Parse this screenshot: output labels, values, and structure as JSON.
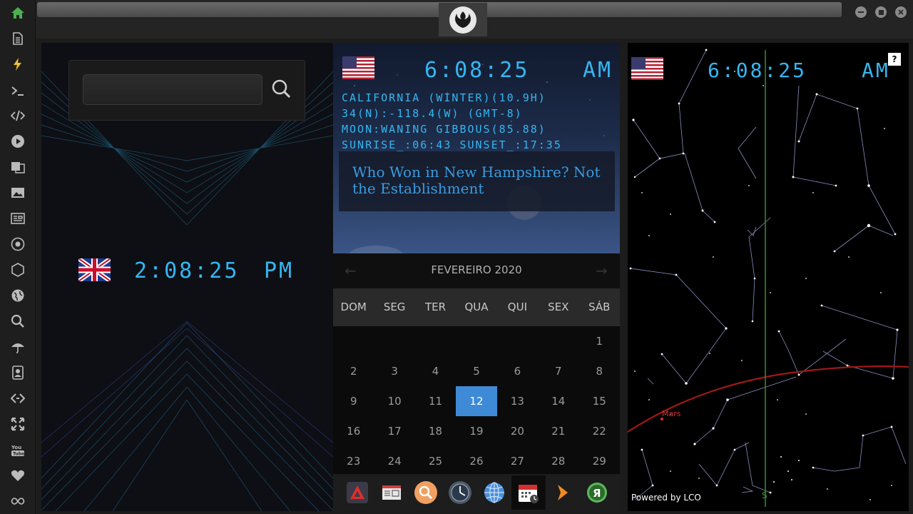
{
  "sidebar": {
    "icons": [
      "home-icon",
      "document-icon",
      "lightning-icon",
      "terminal-icon",
      "code-icon",
      "play-icon",
      "translate-icon",
      "image-icon",
      "news-icon",
      "aperture-icon",
      "hexagon-icon",
      "globe-icon",
      "search-icon",
      "umbrella-icon",
      "contacts-icon",
      "code-tag-icon",
      "expand-icon",
      "youtube-icon",
      "heart-icon",
      "infinity-icon"
    ],
    "accent": "#4caf50"
  },
  "search": {
    "value": "",
    "placeholder": ""
  },
  "uk_clock": {
    "time": "2:08:25",
    "ampm": "PM"
  },
  "us_clock": {
    "time": "6:08:25",
    "ampm": "AM",
    "lines": [
      "CALIFORNIA (WINTER)(10.9H)",
      "34(N):-118.4(W) (GMT-8)",
      "MOON:WANING GIBBOUS(85.88)",
      "SUNRISE_:06:43 SUNSET_:17:35"
    ]
  },
  "news": {
    "headline": "Who Won in New Hampshire? Not the Establishment"
  },
  "calendar": {
    "title": "FEVEREIRO 2020",
    "days": [
      "DOM",
      "SEG",
      "TER",
      "QUA",
      "QUI",
      "SEX",
      "SÁB"
    ],
    "weeks": [
      [
        "",
        "",
        "",
        "",
        "",
        "",
        "1"
      ],
      [
        "2",
        "3",
        "4",
        "5",
        "6",
        "7",
        "8"
      ],
      [
        "9",
        "10",
        "11",
        "12",
        "13",
        "14",
        "15"
      ],
      [
        "16",
        "17",
        "18",
        "19",
        "20",
        "21",
        "22"
      ],
      [
        "23",
        "24",
        "25",
        "26",
        "27",
        "28",
        "29"
      ]
    ],
    "today": "12"
  },
  "dock": {
    "apps": [
      "arch-icon",
      "newspaper-icon",
      "search-app-icon",
      "clock-app-icon",
      "globe-app-icon",
      "calendar-app-icon",
      "arrow-app-icon",
      "yandex-icon"
    ]
  },
  "sky": {
    "time": "6:08:25",
    "ampm": "AM",
    "help": "?",
    "planet_label": "Mars",
    "south_label": "S",
    "powered": "Powered by LCO"
  }
}
